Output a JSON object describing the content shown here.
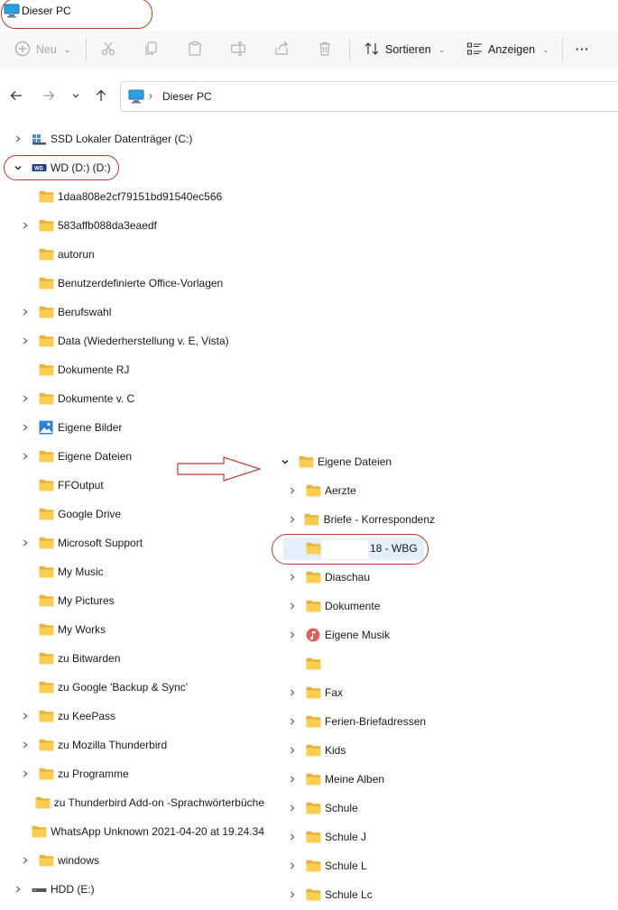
{
  "window": {
    "title": "Dieser PC"
  },
  "toolbar": {
    "new_label": "Neu",
    "sort_label": "Sortieren",
    "view_label": "Anzeigen",
    "more_label": "···"
  },
  "address": {
    "path": "Dieser PC"
  },
  "tree_left": [
    {
      "label": "SSD Lokaler Datenträger (C:)",
      "icon": "ssd-drive-icon"
    },
    {
      "label": "WD (D:) (D:)",
      "icon": "wd-drive-icon"
    },
    {
      "label": "1daa808e2cf79151bd91540ec566",
      "icon": "folder-icon"
    },
    {
      "label": "583affb088da3eaedf",
      "icon": "folder-icon"
    },
    {
      "label": "autorun",
      "icon": "folder-icon"
    },
    {
      "label": "Benutzerdefinierte Office-Vorlagen",
      "icon": "folder-icon"
    },
    {
      "label": "Berufswahl",
      "icon": "folder-icon"
    },
    {
      "label": "Data (Wiederherstellung v. E, Vista)",
      "icon": "folder-icon"
    },
    {
      "label": "Dokumente RJ",
      "icon": "folder-icon"
    },
    {
      "label": "Dokumente v. C",
      "icon": "folder-icon"
    },
    {
      "label": "Eigene Bilder",
      "icon": "pictures-icon"
    },
    {
      "label": "Eigene Dateien",
      "icon": "folder-icon"
    },
    {
      "label": "FFOutput",
      "icon": "folder-icon"
    },
    {
      "label": "Google Drive",
      "icon": "folder-icon"
    },
    {
      "label": "Microsoft Support",
      "icon": "folder-icon"
    },
    {
      "label": "My Music",
      "icon": "folder-icon"
    },
    {
      "label": "My Pictures",
      "icon": "folder-icon"
    },
    {
      "label": "My Works",
      "icon": "folder-icon"
    },
    {
      "label": "zu Bitwarden",
      "icon": "folder-icon"
    },
    {
      "label": "zu Google 'Backup & Sync'",
      "icon": "folder-icon"
    },
    {
      "label": "zu KeePass",
      "icon": "folder-icon"
    },
    {
      "label": "zu Mozilla Thunderbird",
      "icon": "folder-icon"
    },
    {
      "label": "zu Programme",
      "icon": "folder-icon"
    },
    {
      "label": "zu Thunderbird Add-on -Sprachwörterbüche",
      "icon": "folder-icon"
    },
    {
      "label": "WhatsApp Unknown 2021-04-20 at 19.24.34",
      "icon": "folder-icon"
    },
    {
      "label": "windows",
      "icon": "folder-icon"
    },
    {
      "label": "HDD (E:)",
      "icon": "hdd-drive-icon"
    }
  ],
  "tree_right": [
    {
      "label": "Eigene Dateien",
      "icon": "folder-icon"
    },
    {
      "label": "Aerzte",
      "icon": "folder-icon"
    },
    {
      "label": "Briefe - Korrespondenz",
      "icon": "folder-icon"
    },
    {
      "label": "18 - WBG",
      "icon": "folder-icon"
    },
    {
      "label": "Diaschau",
      "icon": "folder-icon"
    },
    {
      "label": "Dokumente",
      "icon": "folder-icon"
    },
    {
      "label": "Eigene Musik",
      "icon": "music-icon"
    },
    {
      "label": "",
      "icon": "folder-icon"
    },
    {
      "label": "Fax",
      "icon": "folder-icon"
    },
    {
      "label": "Ferien-Briefadressen",
      "icon": "folder-icon"
    },
    {
      "label": "Kids",
      "icon": "folder-icon"
    },
    {
      "label": "Meine Alben",
      "icon": "folder-icon"
    },
    {
      "label": "Schule",
      "icon": "folder-icon"
    },
    {
      "label": "Schule J",
      "icon": "folder-icon"
    },
    {
      "label": "Schule L",
      "icon": "folder-icon"
    },
    {
      "label": "Schule Lc",
      "icon": "folder-icon"
    }
  ],
  "colors": {
    "annotation_red": "#c0392b",
    "folder_yellow": "#f8cd52",
    "selection_blue": "#e3efff"
  }
}
